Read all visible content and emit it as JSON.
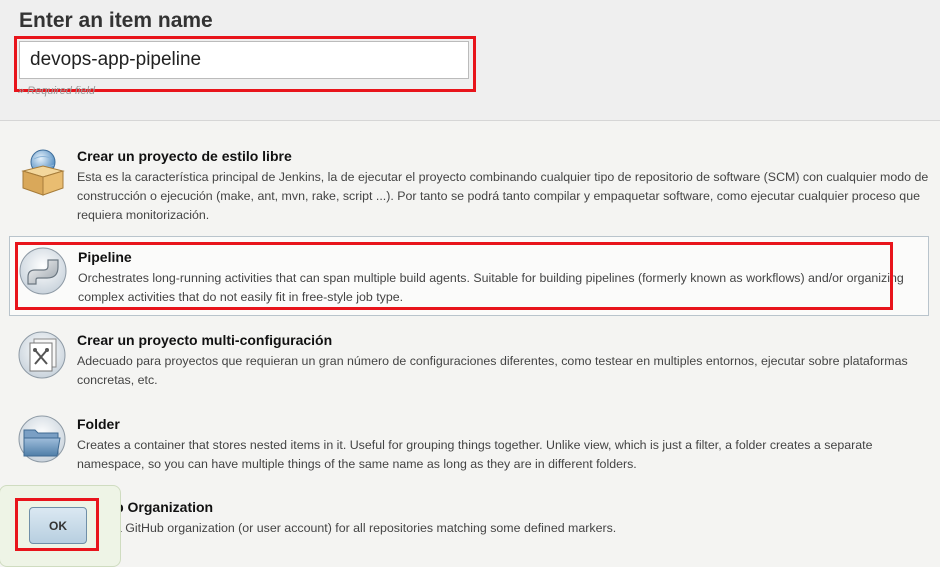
{
  "header": {
    "title": "Enter an item name",
    "item_name_value": "devops-app-pipeline",
    "required_hint": "» Required field"
  },
  "items": [
    {
      "title": "Crear un proyecto de estilo libre",
      "description": "Esta es la característica principal de Jenkins, la de ejecutar el proyecto combinando cualquier tipo de repositorio de software (SCM) con cualquier modo de construcción o ejecución (make, ant, mvn, rake, script ...). Por tanto se podrá tanto compilar y empaquetar software, como ejecutar cualquier proceso que requiera monitorización.",
      "icon": "freestyle-box-icon"
    },
    {
      "title": "Pipeline",
      "description": "Orchestrates long-running activities that can span multiple build agents. Suitable for building pipelines (formerly known as workflows) and/or organizing complex activities that do not easily fit in free-style job type.",
      "icon": "pipe-icon",
      "selected": true
    },
    {
      "title": "Crear un proyecto multi-configuración",
      "description": "Adecuado para proyectos que requieran un gran número de configuraciones diferentes, como testear en multiples entornos, ejecutar sobre plataformas concretas, etc.",
      "icon": "multi-config-icon"
    },
    {
      "title": "Folder",
      "description": "Creates a container that stores nested items in it. Useful for grouping things together. Unlike view, which is just a filter, a folder creates a separate namespace, so you can have multiple things of the same name as long as they are in different folders.",
      "icon": "folder-icon"
    },
    {
      "title": "GitHub Organization",
      "description": "Scans a GitHub organization (or user account) for all repositories matching some defined markers.",
      "icon": "github-org-icon"
    }
  ],
  "footer": {
    "ok_label": "OK"
  },
  "colors": {
    "highlight": "#e8141b",
    "selected_border": "#b9c4cc",
    "ok_panel": "#eef4e6"
  }
}
